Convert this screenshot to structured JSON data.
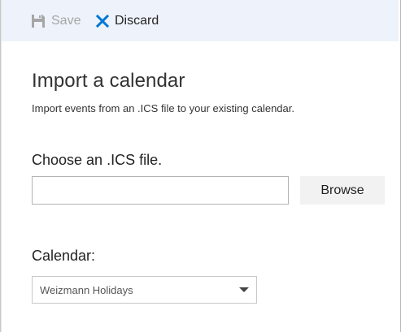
{
  "toolbar": {
    "save_label": "Save",
    "save_icon": "floppy-disk-icon",
    "discard_label": "Discard",
    "discard_icon": "close-x-icon",
    "save_enabled": false,
    "accent_color": "#0078d4",
    "background_color": "#eef2fa"
  },
  "page": {
    "title": "Import a calendar",
    "subtitle": "Import events from an .ICS file to your existing calendar."
  },
  "file_picker": {
    "label": "Choose an .ICS file.",
    "value": "",
    "browse_label": "Browse"
  },
  "calendar": {
    "label": "Calendar:",
    "selected": "Weizmann Holidays",
    "dropdown_icon": "caret-down-icon"
  }
}
